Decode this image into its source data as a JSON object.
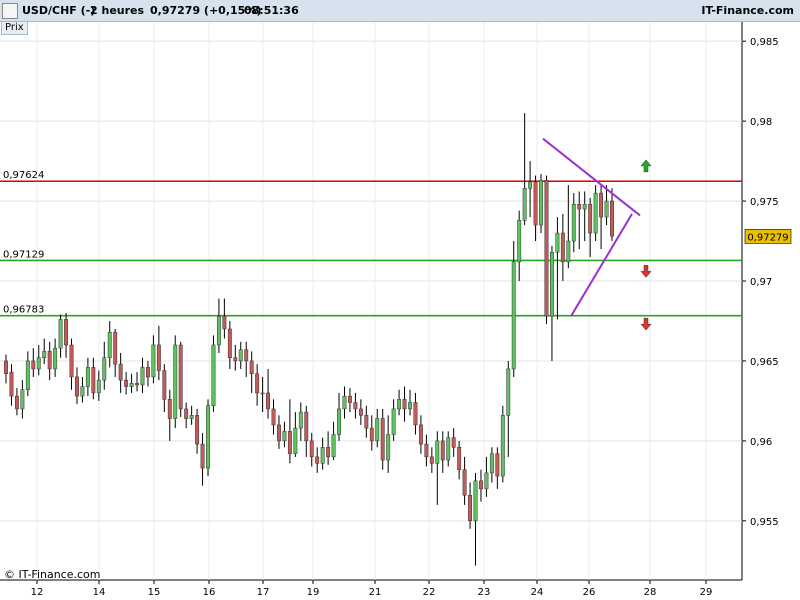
{
  "header": {
    "symbol": "USD/CHF (-)",
    "timeframe": "2 heures",
    "price_change": "0,97279 (+0,15%)",
    "time": "08:51:36",
    "brand": "IT-Finance.com"
  },
  "panel_label": "Prix",
  "copyright": "© IT-Finance.com",
  "current_price_label": "0,97279",
  "colors": {
    "resistance": "#e00000",
    "support": "#22aa22",
    "triangle": "#9933cc",
    "bull_candle": "#5ec35e",
    "bear_candle": "#c45a5a",
    "arrow_up": "#22aa22",
    "arrow_down": "#dd3333",
    "price_tag": "#e8c000"
  },
  "chart_data": {
    "type": "candlestick",
    "title": "USD/CHF (-) 2 heures",
    "x_tick_labels": [
      "12",
      "14",
      "15",
      "16",
      "17",
      "19",
      "21",
      "22",
      "23",
      "24",
      "26",
      "28",
      "29"
    ],
    "y_tick_labels": [
      "0,985",
      "0,98",
      "0,975",
      "0,97",
      "0,965",
      "0,96",
      "0,955"
    ],
    "y_ticks": [
      0.985,
      0.98,
      0.975,
      0.97,
      0.965,
      0.96,
      0.955
    ],
    "ylim": [
      0.9513,
      0.9862
    ],
    "grid": true,
    "current_price": 0.97279,
    "horizontal_levels": [
      {
        "label": "0,97624",
        "value": 0.97624,
        "kind": "resistance"
      },
      {
        "label": "0,97129",
        "value": 0.97129,
        "kind": "support"
      },
      {
        "label": "0,96783",
        "value": 0.96783,
        "kind": "support"
      }
    ],
    "triangle_pattern": {
      "upper_line": [
        [
          0.9789,
          0.9789
        ],
        [
          0.9741,
          0.9741
        ]
      ],
      "lower_line": [
        [
          0.9678,
          0.9678
        ],
        [
          0.9742,
          0.9742
        ]
      ]
    },
    "signal_arrows": [
      {
        "direction": "up",
        "price": 0.9772
      },
      {
        "direction": "down",
        "price": 0.9706
      },
      {
        "direction": "down",
        "price": 0.9673
      }
    ],
    "candles": [
      [
        0.965,
        0.9642,
        0.9654,
        0.9636
      ],
      [
        0.9643,
        0.9628,
        0.9648,
        0.9622
      ],
      [
        0.9628,
        0.962,
        0.9633,
        0.9616
      ],
      [
        0.962,
        0.9632,
        0.9638,
        0.9614
      ],
      [
        0.9632,
        0.965,
        0.9656,
        0.9628
      ],
      [
        0.965,
        0.9645,
        0.9658,
        0.964
      ],
      [
        0.9645,
        0.9652,
        0.966,
        0.9641
      ],
      [
        0.9652,
        0.9656,
        0.9664,
        0.9648
      ],
      [
        0.9656,
        0.9645,
        0.9662,
        0.9638
      ],
      [
        0.9645,
        0.9658,
        0.9664,
        0.964
      ],
      [
        0.9658,
        0.9676,
        0.9679,
        0.9652
      ],
      [
        0.9676,
        0.966,
        0.968,
        0.9652
      ],
      [
        0.966,
        0.964,
        0.9664,
        0.9632
      ],
      [
        0.964,
        0.9628,
        0.9646,
        0.9623
      ],
      [
        0.9628,
        0.9634,
        0.964,
        0.9624
      ],
      [
        0.9634,
        0.9646,
        0.9652,
        0.9628
      ],
      [
        0.9646,
        0.963,
        0.9652,
        0.9626
      ],
      [
        0.963,
        0.9638,
        0.9644,
        0.9625
      ],
      [
        0.9638,
        0.9652,
        0.9662,
        0.9632
      ],
      [
        0.9652,
        0.9668,
        0.9675,
        0.9646
      ],
      [
        0.9668,
        0.9648,
        0.967,
        0.964
      ],
      [
        0.9648,
        0.9638,
        0.9655,
        0.963
      ],
      [
        0.9638,
        0.9634,
        0.9643,
        0.9629
      ],
      [
        0.9634,
        0.9636,
        0.9642,
        0.963
      ],
      [
        0.9636,
        0.9635,
        0.9643,
        0.9631
      ],
      [
        0.9635,
        0.9646,
        0.9652,
        0.963
      ],
      [
        0.9646,
        0.964,
        0.965,
        0.9634
      ],
      [
        0.964,
        0.966,
        0.9666,
        0.9636
      ],
      [
        0.966,
        0.9644,
        0.9672,
        0.9638
      ],
      [
        0.9644,
        0.9626,
        0.9648,
        0.9618
      ],
      [
        0.9626,
        0.9614,
        0.9632,
        0.96
      ],
      [
        0.9614,
        0.966,
        0.9666,
        0.9608
      ],
      [
        0.966,
        0.962,
        0.9662,
        0.9615
      ],
      [
        0.962,
        0.9614,
        0.9624,
        0.9608
      ],
      [
        0.9614,
        0.9616,
        0.9622,
        0.961
      ],
      [
        0.9616,
        0.9598,
        0.962,
        0.9592
      ],
      [
        0.9598,
        0.9583,
        0.9605,
        0.9572
      ],
      [
        0.9583,
        0.9622,
        0.9626,
        0.9578
      ],
      [
        0.9622,
        0.966,
        0.9666,
        0.9618
      ],
      [
        0.966,
        0.9678,
        0.9689,
        0.9655
      ],
      [
        0.9678,
        0.967,
        0.9689,
        0.9664
      ],
      [
        0.967,
        0.9652,
        0.9675,
        0.9645
      ],
      [
        0.9652,
        0.965,
        0.966,
        0.9644
      ],
      [
        0.965,
        0.9657,
        0.9662,
        0.9645
      ],
      [
        0.9657,
        0.965,
        0.9662,
        0.964
      ],
      [
        0.965,
        0.9642,
        0.9656,
        0.963
      ],
      [
        0.9642,
        0.963,
        0.9648,
        0.9622
      ],
      [
        0.963,
        0.963,
        0.964,
        0.9618
      ],
      [
        0.963,
        0.962,
        0.9645,
        0.9614
      ],
      [
        0.962,
        0.961,
        0.9626,
        0.9604
      ],
      [
        0.961,
        0.96,
        0.9616,
        0.9595
      ],
      [
        0.96,
        0.9606,
        0.9612,
        0.9596
      ],
      [
        0.9606,
        0.9592,
        0.9626,
        0.9586
      ],
      [
        0.9592,
        0.9608,
        0.9618,
        0.959
      ],
      [
        0.9608,
        0.9618,
        0.9624,
        0.96
      ],
      [
        0.9618,
        0.96,
        0.9622,
        0.959
      ],
      [
        0.96,
        0.959,
        0.9605,
        0.9584
      ],
      [
        0.959,
        0.9586,
        0.9596,
        0.958
      ],
      [
        0.9586,
        0.9596,
        0.9602,
        0.9582
      ],
      [
        0.9596,
        0.959,
        0.9606,
        0.9585
      ],
      [
        0.959,
        0.9604,
        0.9612,
        0.9588
      ],
      [
        0.9604,
        0.962,
        0.963,
        0.96
      ],
      [
        0.962,
        0.9628,
        0.9634,
        0.9614
      ],
      [
        0.9628,
        0.9624,
        0.9633,
        0.9618
      ],
      [
        0.9624,
        0.962,
        0.963,
        0.9614
      ],
      [
        0.962,
        0.9616,
        0.9626,
        0.961
      ],
      [
        0.9616,
        0.9608,
        0.9622,
        0.9602
      ],
      [
        0.9608,
        0.96,
        0.9616,
        0.9594
      ],
      [
        0.96,
        0.9614,
        0.962,
        0.9596
      ],
      [
        0.9614,
        0.9588,
        0.962,
        0.9582
      ],
      [
        0.9588,
        0.9604,
        0.9616,
        0.958
      ],
      [
        0.9604,
        0.962,
        0.9626,
        0.96
      ],
      [
        0.962,
        0.9626,
        0.9632,
        0.9616
      ],
      [
        0.9626,
        0.962,
        0.9634,
        0.9612
      ],
      [
        0.962,
        0.9624,
        0.9632,
        0.9616
      ],
      [
        0.9624,
        0.961,
        0.963,
        0.9604
      ],
      [
        0.961,
        0.9598,
        0.9616,
        0.9592
      ],
      [
        0.9598,
        0.959,
        0.9604,
        0.9584
      ],
      [
        0.959,
        0.9586,
        0.9596,
        0.958
      ],
      [
        0.9586,
        0.96,
        0.9606,
        0.956
      ],
      [
        0.96,
        0.9588,
        0.9606,
        0.958
      ],
      [
        0.9588,
        0.9602,
        0.9606,
        0.9584
      ],
      [
        0.9602,
        0.9596,
        0.9608,
        0.959
      ],
      [
        0.9596,
        0.9582,
        0.96,
        0.9576
      ],
      [
        0.9582,
        0.9566,
        0.959,
        0.956
      ],
      [
        0.9566,
        0.955,
        0.9574,
        0.9545
      ],
      [
        0.955,
        0.9575,
        0.958,
        0.9522
      ],
      [
        0.9575,
        0.957,
        0.9582,
        0.9562
      ],
      [
        0.957,
        0.958,
        0.959,
        0.9565
      ],
      [
        0.958,
        0.9592,
        0.9596,
        0.9574
      ],
      [
        0.9592,
        0.9578,
        0.9596,
        0.957
      ],
      [
        0.9578,
        0.9616,
        0.9622,
        0.9574
      ],
      [
        0.9616,
        0.9645,
        0.965,
        0.959
      ],
      [
        0.9645,
        0.9712,
        0.9725,
        0.964
      ],
      [
        0.9712,
        0.9738,
        0.9744,
        0.97
      ],
      [
        0.9738,
        0.9758,
        0.9805,
        0.9735
      ],
      [
        0.9758,
        0.9762,
        0.9775,
        0.974
      ],
      [
        0.9762,
        0.9735,
        0.9766,
        0.9725
      ],
      [
        0.9735,
        0.9763,
        0.9767,
        0.973
      ],
      [
        0.9763,
        0.9678,
        0.9766,
        0.9673
      ],
      [
        0.9678,
        0.9718,
        0.9722,
        0.965
      ],
      [
        0.9718,
        0.973,
        0.974,
        0.9676
      ],
      [
        0.973,
        0.9712,
        0.9742,
        0.97
      ],
      [
        0.9712,
        0.9725,
        0.976,
        0.9708
      ],
      [
        0.9725,
        0.9748,
        0.9755,
        0.9718
      ],
      [
        0.9748,
        0.9745,
        0.9756,
        0.972
      ],
      [
        0.9745,
        0.9748,
        0.9756,
        0.9725
      ],
      [
        0.9748,
        0.973,
        0.9752,
        0.9715
      ],
      [
        0.973,
        0.9755,
        0.976,
        0.9725
      ],
      [
        0.9755,
        0.974,
        0.976,
        0.972
      ],
      [
        0.974,
        0.975,
        0.976,
        0.9735
      ],
      [
        0.975,
        0.9728,
        0.9758,
        0.9725
      ]
    ]
  }
}
